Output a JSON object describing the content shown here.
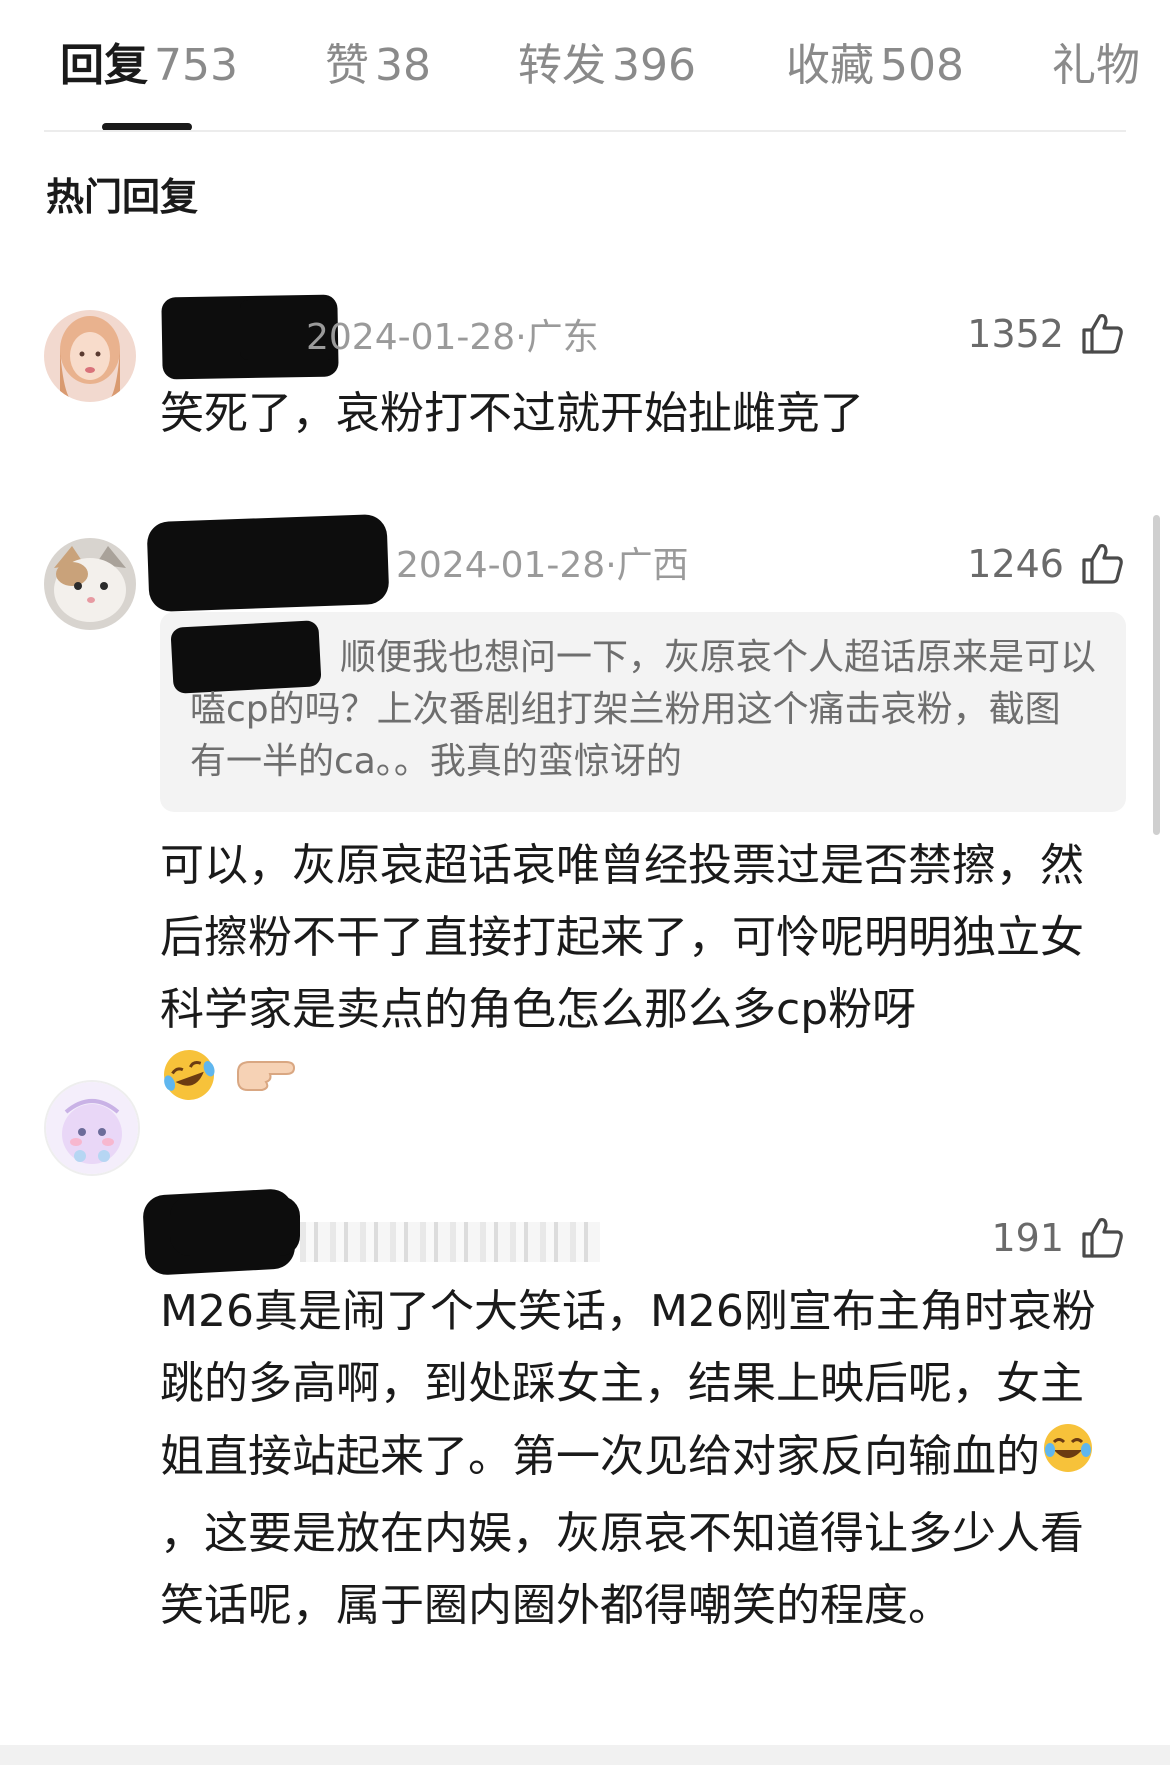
{
  "tabs": [
    {
      "label": "回复",
      "count": "753"
    },
    {
      "label": "赞",
      "count": "38"
    },
    {
      "label": "转发",
      "count": "396"
    },
    {
      "label": "收藏",
      "count": "508"
    },
    {
      "label": "礼物",
      "count": ""
    }
  ],
  "section_title": "热门回复",
  "comments": [
    {
      "date": "2024-01-28·",
      "location": "广东",
      "likes": "1352",
      "text": "笑死了，哀粉打不过就开始扯雌竞了"
    },
    {
      "date": "2024-01-28·",
      "location": "广西",
      "likes": "1246",
      "quote": "顺便我也想问一下，灰原哀个人超话原来是可以嗑cp的吗？上次番剧组打架兰粉用这个痛击哀粉，截图有一半的ca。。我真的蛮惊讶的",
      "text": "可以，灰原哀超话哀唯曾经投票过是否禁擦，然后擦粉不干了直接打起来了，可怜呢明明独立女科学家是卖点的角色怎么那么多cp粉呀"
    },
    {
      "likes": "191",
      "text_part1": "M26真是闹了个大笑话，M26刚宣布主角时哀粉跳的多高啊，到处踩女主，结果上映后呢，女主姐直接站起来了。第一次见给对家反向输血的",
      "text_part2": "，这要是放在内娱，灰原哀不知道得让多少人看笑话呢，属于圈内圈外都得嘲笑的程度。"
    }
  ],
  "icons": {
    "like": "thumbs-up-icon",
    "emoji_laugh": "rolling-laughing-emoji",
    "emoji_point": "pointing-hand-emoji",
    "emoji_tears": "tears-of-joy-emoji"
  },
  "colors": {
    "text": "#1a1a1a",
    "muted": "#9a9a9a",
    "quote_bg": "#f3f3f3"
  }
}
